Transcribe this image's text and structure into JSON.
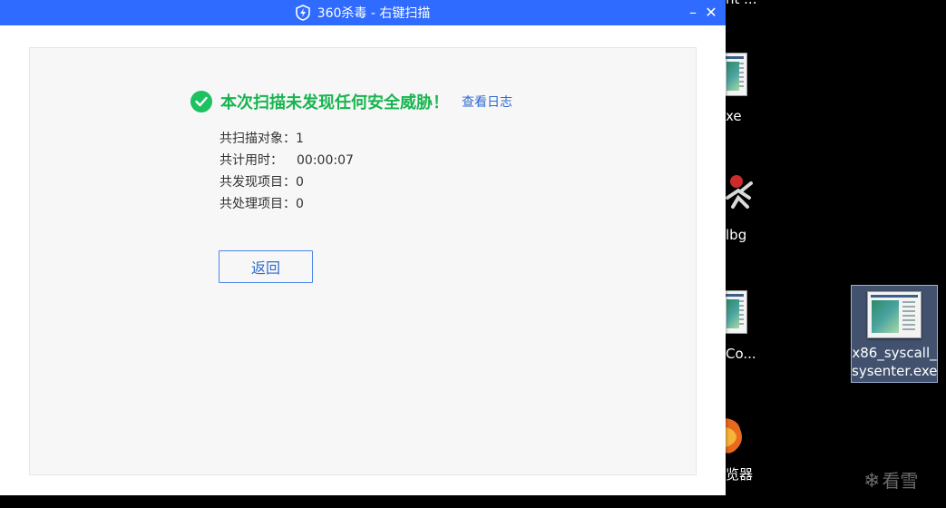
{
  "window": {
    "title": "360杀毒 - 右键扫描",
    "minimize": "–",
    "close": "✕"
  },
  "result": {
    "title": "本次扫描未发现任何安全威胁！",
    "log_link": "查看日志"
  },
  "stats": [
    {
      "label": "共扫描对象：",
      "value": "1"
    },
    {
      "label": "共计用时：",
      "value": "00:00:07"
    },
    {
      "label": "共发现项目：",
      "value": "0"
    },
    {
      "label": "共处理项目：",
      "value": "0"
    }
  ],
  "back_button": "返回",
  "desktop": {
    "partial_labels": [
      "nt ...",
      "xe",
      "lbg",
      "Co...",
      "览器"
    ],
    "selected_item": {
      "line1": "x86_syscall_",
      "line2": "sysenter.exe"
    },
    "watermark": "看雪",
    "watermark_icon": "snowflake-icon"
  }
}
